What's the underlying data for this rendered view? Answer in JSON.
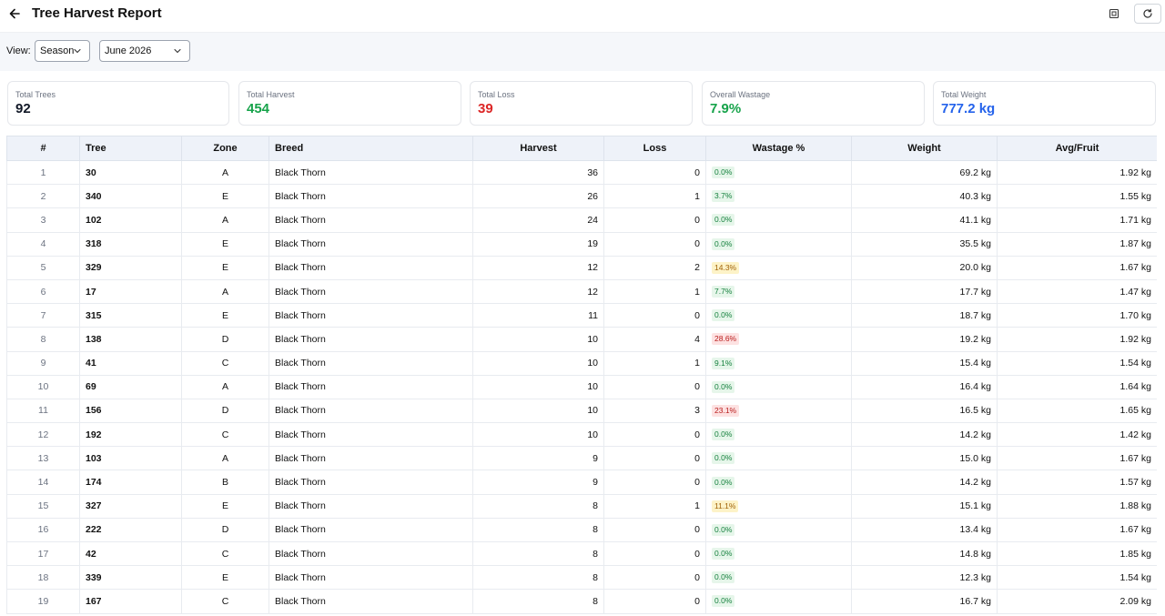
{
  "header": {
    "title": "Tree Harvest Report"
  },
  "filters": {
    "view_label": "View:",
    "season_value": "Season",
    "month_value": "June 2026"
  },
  "stats": [
    {
      "label": "Total Trees",
      "value": "92",
      "color": "#111827"
    },
    {
      "label": "Total Harvest",
      "value": "454",
      "color": "#16a34a"
    },
    {
      "label": "Total Loss",
      "value": "39",
      "color": "#dc2626"
    },
    {
      "label": "Overall Wastage",
      "value": "7.9%",
      "color": "#16a34a"
    },
    {
      "label": "Total Weight",
      "value": "777.2 kg",
      "color": "#2563eb"
    }
  ],
  "table": {
    "columns": [
      "#",
      "Tree",
      "Zone",
      "Breed",
      "Harvest",
      "Loss",
      "Wastage %",
      "Weight",
      "Avg/Fruit"
    ],
    "rows": [
      {
        "n": "1",
        "tree": "30",
        "zone": "A",
        "breed": "Black Thorn",
        "harvest": "36",
        "loss": "0",
        "wastage": "0.0%",
        "level": "green",
        "weight": "69.2 kg",
        "avg": "1.92 kg"
      },
      {
        "n": "2",
        "tree": "340",
        "zone": "E",
        "breed": "Black Thorn",
        "harvest": "26",
        "loss": "1",
        "wastage": "3.7%",
        "level": "green",
        "weight": "40.3 kg",
        "avg": "1.55 kg"
      },
      {
        "n": "3",
        "tree": "102",
        "zone": "A",
        "breed": "Black Thorn",
        "harvest": "24",
        "loss": "0",
        "wastage": "0.0%",
        "level": "green",
        "weight": "41.1 kg",
        "avg": "1.71 kg"
      },
      {
        "n": "4",
        "tree": "318",
        "zone": "E",
        "breed": "Black Thorn",
        "harvest": "19",
        "loss": "0",
        "wastage": "0.0%",
        "level": "green",
        "weight": "35.5 kg",
        "avg": "1.87 kg"
      },
      {
        "n": "5",
        "tree": "329",
        "zone": "E",
        "breed": "Black Thorn",
        "harvest": "12",
        "loss": "2",
        "wastage": "14.3%",
        "level": "yellow",
        "weight": "20.0 kg",
        "avg": "1.67 kg"
      },
      {
        "n": "6",
        "tree": "17",
        "zone": "A",
        "breed": "Black Thorn",
        "harvest": "12",
        "loss": "1",
        "wastage": "7.7%",
        "level": "green",
        "weight": "17.7 kg",
        "avg": "1.47 kg"
      },
      {
        "n": "7",
        "tree": "315",
        "zone": "E",
        "breed": "Black Thorn",
        "harvest": "11",
        "loss": "0",
        "wastage": "0.0%",
        "level": "green",
        "weight": "18.7 kg",
        "avg": "1.70 kg"
      },
      {
        "n": "8",
        "tree": "138",
        "zone": "D",
        "breed": "Black Thorn",
        "harvest": "10",
        "loss": "4",
        "wastage": "28.6%",
        "level": "red",
        "weight": "19.2 kg",
        "avg": "1.92 kg"
      },
      {
        "n": "9",
        "tree": "41",
        "zone": "C",
        "breed": "Black Thorn",
        "harvest": "10",
        "loss": "1",
        "wastage": "9.1%",
        "level": "green",
        "weight": "15.4 kg",
        "avg": "1.54 kg"
      },
      {
        "n": "10",
        "tree": "69",
        "zone": "A",
        "breed": "Black Thorn",
        "harvest": "10",
        "loss": "0",
        "wastage": "0.0%",
        "level": "green",
        "weight": "16.4 kg",
        "avg": "1.64 kg"
      },
      {
        "n": "11",
        "tree": "156",
        "zone": "D",
        "breed": "Black Thorn",
        "harvest": "10",
        "loss": "3",
        "wastage": "23.1%",
        "level": "red",
        "weight": "16.5 kg",
        "avg": "1.65 kg"
      },
      {
        "n": "12",
        "tree": "192",
        "zone": "C",
        "breed": "Black Thorn",
        "harvest": "10",
        "loss": "0",
        "wastage": "0.0%",
        "level": "green",
        "weight": "14.2 kg",
        "avg": "1.42 kg"
      },
      {
        "n": "13",
        "tree": "103",
        "zone": "A",
        "breed": "Black Thorn",
        "harvest": "9",
        "loss": "0",
        "wastage": "0.0%",
        "level": "green",
        "weight": "15.0 kg",
        "avg": "1.67 kg"
      },
      {
        "n": "14",
        "tree": "174",
        "zone": "B",
        "breed": "Black Thorn",
        "harvest": "9",
        "loss": "0",
        "wastage": "0.0%",
        "level": "green",
        "weight": "14.2 kg",
        "avg": "1.57 kg"
      },
      {
        "n": "15",
        "tree": "327",
        "zone": "E",
        "breed": "Black Thorn",
        "harvest": "8",
        "loss": "1",
        "wastage": "11.1%",
        "level": "yellow",
        "weight": "15.1 kg",
        "avg": "1.88 kg"
      },
      {
        "n": "16",
        "tree": "222",
        "zone": "D",
        "breed": "Black Thorn",
        "harvest": "8",
        "loss": "0",
        "wastage": "0.0%",
        "level": "green",
        "weight": "13.4 kg",
        "avg": "1.67 kg"
      },
      {
        "n": "17",
        "tree": "42",
        "zone": "C",
        "breed": "Black Thorn",
        "harvest": "8",
        "loss": "0",
        "wastage": "0.0%",
        "level": "green",
        "weight": "14.8 kg",
        "avg": "1.85 kg"
      },
      {
        "n": "18",
        "tree": "339",
        "zone": "E",
        "breed": "Black Thorn",
        "harvest": "8",
        "loss": "0",
        "wastage": "0.0%",
        "level": "green",
        "weight": "12.3 kg",
        "avg": "1.54 kg"
      },
      {
        "n": "19",
        "tree": "167",
        "zone": "C",
        "breed": "Black Thorn",
        "harvest": "8",
        "loss": "0",
        "wastage": "0.0%",
        "level": "green",
        "weight": "16.7 kg",
        "avg": "2.09 kg"
      }
    ]
  }
}
